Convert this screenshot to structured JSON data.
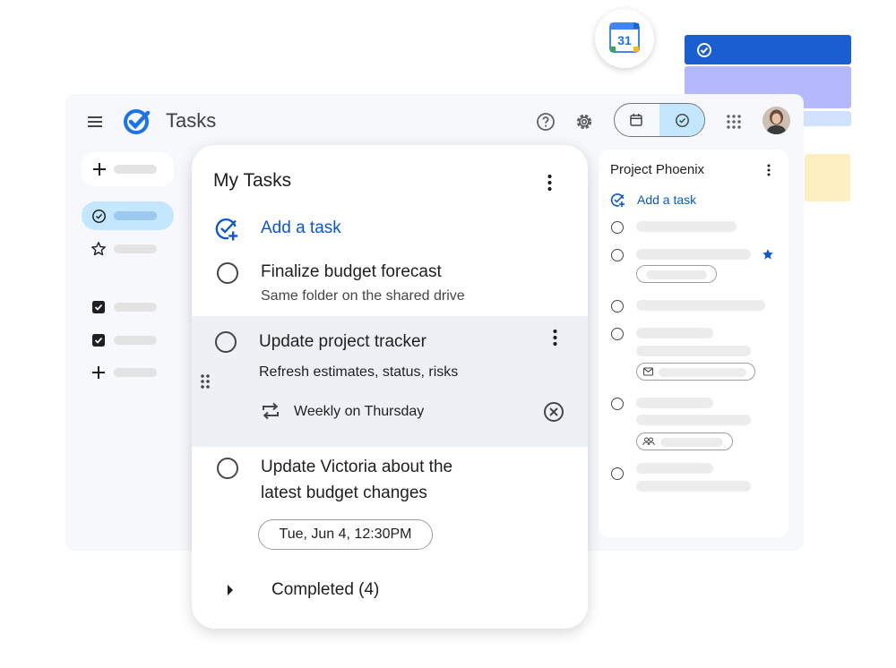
{
  "app": {
    "title": "Tasks",
    "calendar_badge_day": "31"
  },
  "main_list": {
    "title": "My Tasks",
    "add_task_label": "Add a task",
    "tasks": [
      {
        "title": "Finalize budget forecast",
        "details": "Same folder on the shared drive"
      },
      {
        "title": "Update project tracker",
        "details": "Refresh estimates, status, risks",
        "repeat": "Weekly on Thursday"
      },
      {
        "title_line1": "Update Victoria about the",
        "title_line2": "latest budget changes",
        "date_chip": "Tue, Jun 4, 12:30PM"
      }
    ],
    "completed_label": "Completed (4)"
  },
  "side_list": {
    "title": "Project Phoenix",
    "add_task_label": "Add a task"
  },
  "colors": {
    "accent": "#0b57d0",
    "brand_blue": "#1a73e8",
    "highlight": "#c2e7ff"
  }
}
